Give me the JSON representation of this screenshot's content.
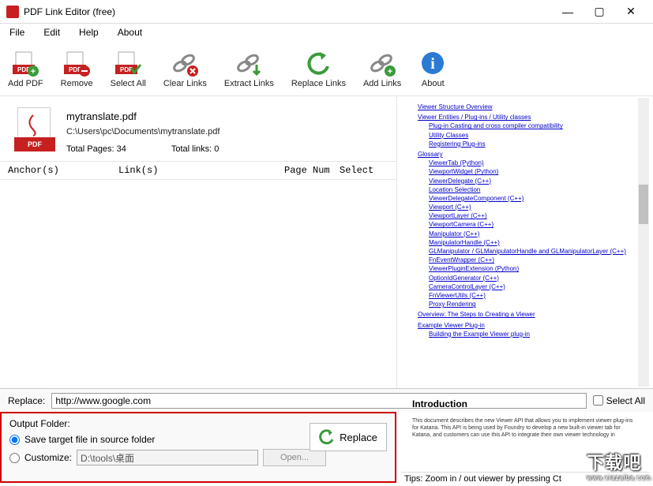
{
  "window": {
    "title": "PDF Link Editor (free)"
  },
  "menu": {
    "file": "File",
    "edit": "Edit",
    "help": "Help",
    "about": "About"
  },
  "toolbar": {
    "add": "Add PDF",
    "remove": "Remove",
    "selectall": "Select All",
    "clear": "Clear Links",
    "extract": "Extract Links",
    "replace": "Replace Links",
    "addlinks": "Add Links",
    "about": "About"
  },
  "file": {
    "name": "mytranslate.pdf",
    "path": "C:\\Users\\pc\\Documents\\mytranslate.pdf",
    "pages": "Total Pages: 34",
    "links": "Total links: 0",
    "iconlabel": "PDF"
  },
  "table": {
    "anchor": "Anchor(s)",
    "link": "Link(s)",
    "page": "Page Num",
    "select": "Select"
  },
  "replace": {
    "label": "Replace:",
    "value": "http://www.google.com",
    "selectall": "Select All"
  },
  "output": {
    "title": "Output Folder:",
    "opt1": "Save target file in source folder",
    "opt2": "Customize:",
    "custompath": "D:\\tools\\桌面",
    "open": "Open...",
    "replace": "Replace"
  },
  "doc": {
    "links": [
      {
        "lvl": 1,
        "t": "Viewer Structure Overview"
      },
      {
        "lvl": 1,
        "t": "Viewer Entities / Plug-ins / Utility classes"
      },
      {
        "lvl": 2,
        "t": "Plug-in Casting and cross compiler compatibility"
      },
      {
        "lvl": 2,
        "t": "Utility Classes"
      },
      {
        "lvl": 2,
        "t": "Registering Plug-ins"
      },
      {
        "lvl": 1,
        "t": "Glossary"
      },
      {
        "lvl": 2,
        "t": "ViewerTab (Python)"
      },
      {
        "lvl": 2,
        "t": "ViewportWidget (Python)"
      },
      {
        "lvl": 2,
        "t": "ViewerDelegate (C++)"
      },
      {
        "lvl": 2,
        "t": "Location Selection"
      },
      {
        "lvl": 2,
        "t": "ViewerDelegateComponent (C++)"
      },
      {
        "lvl": 2,
        "t": "Viewport (C++)"
      },
      {
        "lvl": 2,
        "t": "ViewportLayer (C++)"
      },
      {
        "lvl": 2,
        "t": "ViewportCamera (C++)"
      },
      {
        "lvl": 2,
        "t": "Manipulator (C++)"
      },
      {
        "lvl": 2,
        "t": "ManipulatorHandle (C++)"
      },
      {
        "lvl": 2,
        "t": "GLManipulator / GLManipulatorHandle and GLManipulatorLayer (C++)"
      },
      {
        "lvl": 2,
        "t": "FnEventWrapper (C++)"
      },
      {
        "lvl": 2,
        "t": "ViewerPluginExtension (Python)"
      },
      {
        "lvl": 2,
        "t": "OptionIdGenerator (C++)"
      },
      {
        "lvl": 2,
        "t": "CameraControlLayer (C++)"
      },
      {
        "lvl": 2,
        "t": "FnViewerUtils (C++)"
      },
      {
        "lvl": 2,
        "t": "Proxy Rendering"
      },
      {
        "lvl": 1,
        "t": "Overview: The Steps to Creating a Viewer"
      },
      {
        "lvl": 1,
        "t": "Example Viewer Plug-in"
      },
      {
        "lvl": 2,
        "t": "Building the Example Viewer plug-in"
      }
    ],
    "intro_title": "Introduction",
    "intro_body": "This document describes the new Viewer API that allows you to implement viewer plug-ins for Katana. This API is being used by Foundry to develop a new built-in viewer tab for Katana, and customers can use this API to integrate their own viewer technology in"
  },
  "tips": "Tips: Zoom in / out viewer by pressing Ct",
  "watermark": {
    "main": "下载吧",
    "sub": "www.xiazaiba.com"
  }
}
